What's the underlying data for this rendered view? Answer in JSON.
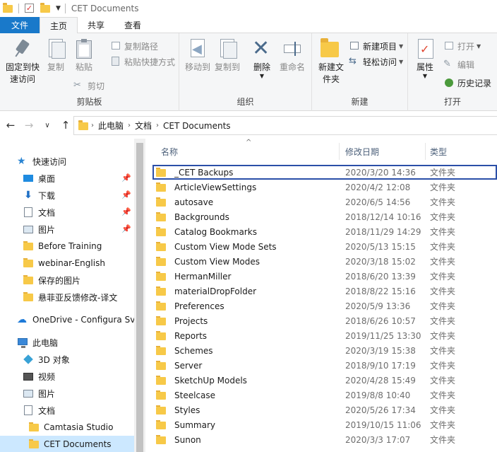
{
  "window": {
    "title": "CET Documents"
  },
  "ribbon_tabs": [
    "文件",
    "主页",
    "共享",
    "查看"
  ],
  "ribbon": {
    "clipboard": {
      "label": "剪贴板",
      "pin_quick_access": "固定到快速访问",
      "copy": "复制",
      "paste": "粘贴",
      "copy_path": "复制路径",
      "paste_shortcut": "粘贴快捷方式",
      "cut": "剪切"
    },
    "organize": {
      "label": "组织",
      "move_to": "移动到",
      "copy_to": "复制到",
      "delete": "删除",
      "rename": "重命名"
    },
    "new": {
      "label": "新建",
      "new_folder": "新建文件夹",
      "new_item": "新建项目",
      "easy_access": "轻松访问"
    },
    "open": {
      "label": "打开",
      "properties": "属性",
      "open": "打开",
      "edit": "编辑",
      "history": "历史记录"
    }
  },
  "address": {
    "segments": [
      "此电脑",
      "文档",
      "CET Documents"
    ]
  },
  "nav_pane": {
    "quick_access": "快速访问",
    "items": [
      {
        "label": "桌面",
        "icon": "desktop-icon",
        "pinned": true
      },
      {
        "label": "下载",
        "icon": "download-icon",
        "pinned": true
      },
      {
        "label": "文档",
        "icon": "documents-icon",
        "pinned": true
      },
      {
        "label": "图片",
        "icon": "pictures-icon",
        "pinned": true
      },
      {
        "label": "Before Training",
        "icon": "folder-icon",
        "pinned": false
      },
      {
        "label": "webinar-English",
        "icon": "folder-icon",
        "pinned": false
      },
      {
        "label": "保存的图片",
        "icon": "folder-icon",
        "pinned": false
      },
      {
        "label": "悬菲亚反馈修改-译文",
        "icon": "folder-icon",
        "pinned": false
      }
    ],
    "onedrive": "OneDrive - Configura Sve",
    "this_pc": "此电脑",
    "pc_items": [
      {
        "label": "3D 对象",
        "icon": "3d-objects-icon"
      },
      {
        "label": "视频",
        "icon": "videos-icon"
      },
      {
        "label": "图片",
        "icon": "pictures-icon"
      },
      {
        "label": "文档",
        "icon": "documents-icon"
      }
    ],
    "doc_children": [
      {
        "label": "Camtasia Studio",
        "selected": false
      },
      {
        "label": "CET Documents",
        "selected": true
      }
    ]
  },
  "file_list": {
    "columns": {
      "name": "名称",
      "date": "修改日期",
      "type": "类型"
    },
    "rows": [
      {
        "name": "_CET Backups",
        "date": "2020/3/20 14:36",
        "type": "文件夹",
        "highlight": true
      },
      {
        "name": "ArticleViewSettings",
        "date": "2020/4/2 12:08",
        "type": "文件夹"
      },
      {
        "name": "autosave",
        "date": "2020/6/5 14:56",
        "type": "文件夹"
      },
      {
        "name": "Backgrounds",
        "date": "2018/12/14 10:16",
        "type": "文件夹"
      },
      {
        "name": "Catalog Bookmarks",
        "date": "2018/11/29 14:29",
        "type": "文件夹"
      },
      {
        "name": "Custom View Mode Sets",
        "date": "2020/5/13 15:15",
        "type": "文件夹"
      },
      {
        "name": "Custom View Modes",
        "date": "2020/3/18 15:02",
        "type": "文件夹"
      },
      {
        "name": "HermanMiller",
        "date": "2018/6/20 13:39",
        "type": "文件夹"
      },
      {
        "name": "materialDropFolder",
        "date": "2018/8/22 15:16",
        "type": "文件夹"
      },
      {
        "name": "Preferences",
        "date": "2020/5/9 13:36",
        "type": "文件夹"
      },
      {
        "name": "Projects",
        "date": "2018/6/26 10:57",
        "type": "文件夹"
      },
      {
        "name": "Reports",
        "date": "2019/11/25 13:30",
        "type": "文件夹"
      },
      {
        "name": "Schemes",
        "date": "2020/3/19 15:38",
        "type": "文件夹"
      },
      {
        "name": "Server",
        "date": "2018/9/10 17:19",
        "type": "文件夹"
      },
      {
        "name": "SketchUp Models",
        "date": "2020/4/28 15:49",
        "type": "文件夹"
      },
      {
        "name": "Steelcase",
        "date": "2019/8/8 10:40",
        "type": "文件夹"
      },
      {
        "name": "Styles",
        "date": "2020/5/26 17:34",
        "type": "文件夹"
      },
      {
        "name": "Summary",
        "date": "2019/10/15 11:06",
        "type": "文件夹"
      },
      {
        "name": "Sunon",
        "date": "2020/3/3 17:07",
        "type": "文件夹"
      }
    ]
  },
  "colors": {
    "file_tab": "#1979ca",
    "selection": "#cce8ff",
    "highlight_box": "#2b4fa8",
    "folder": "#f7c948"
  }
}
